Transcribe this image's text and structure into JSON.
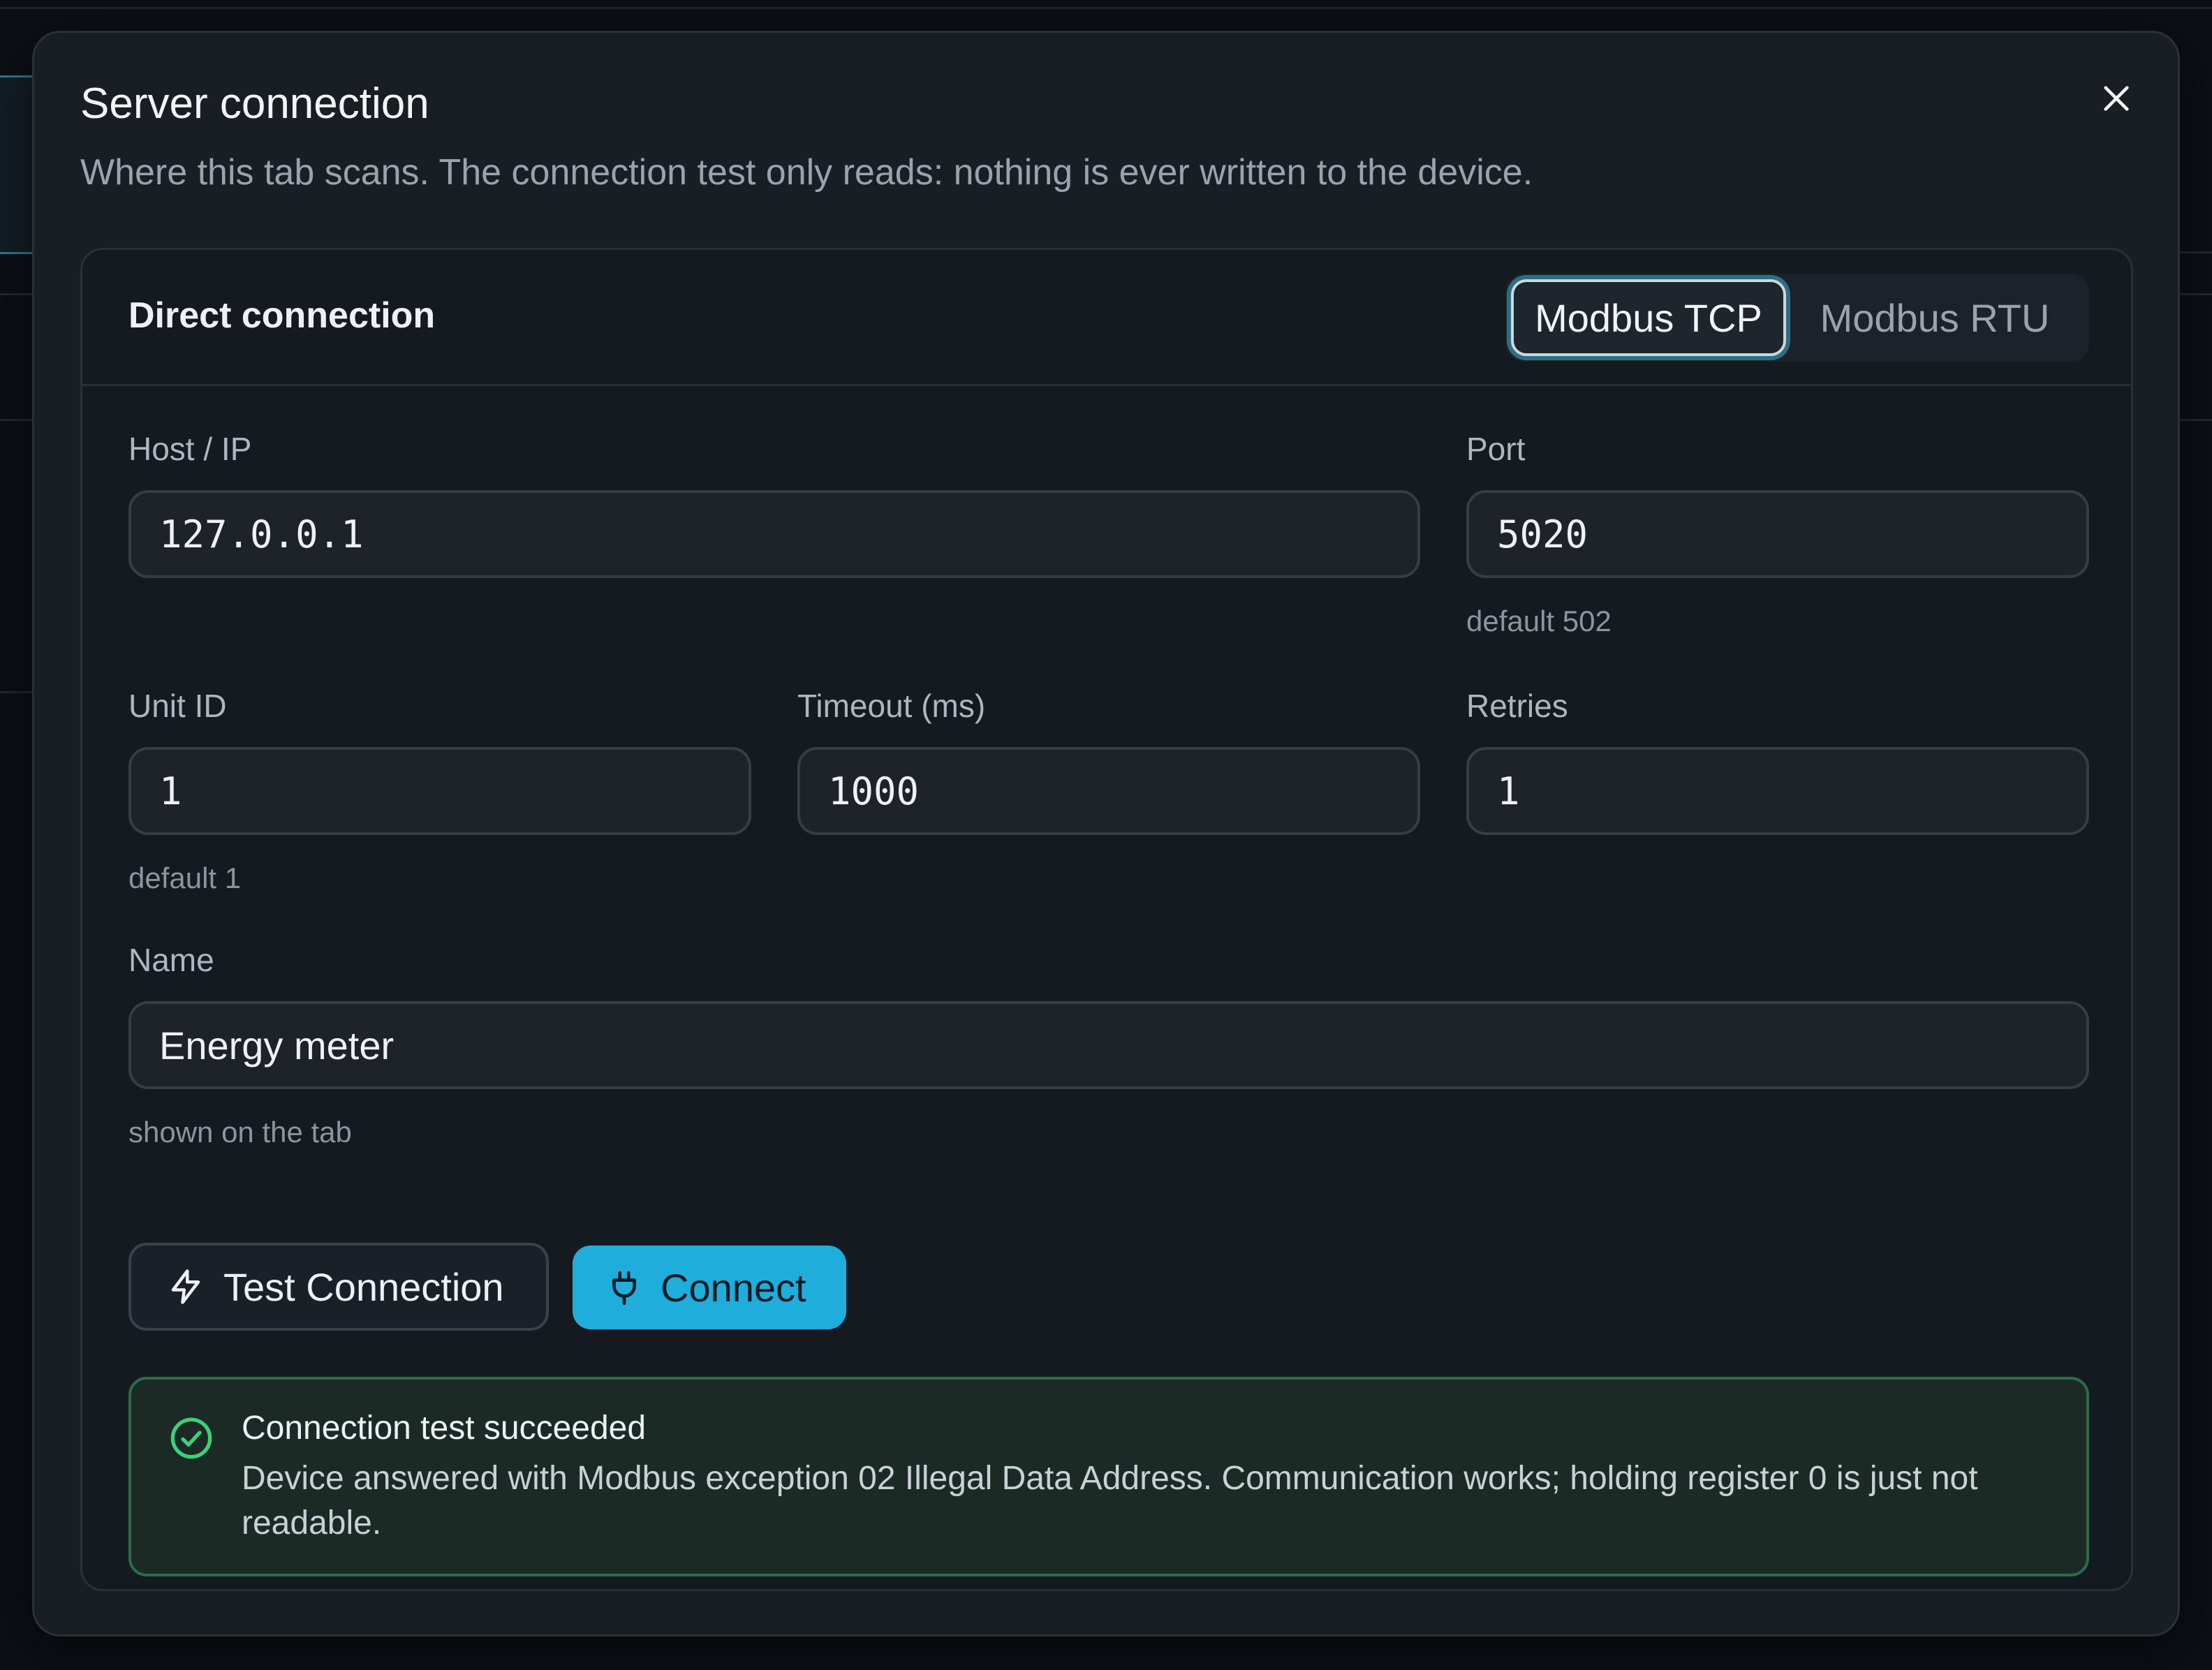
{
  "dialog": {
    "title": "Server connection",
    "subtitle": "Where this tab scans. The connection test only reads: nothing is ever written to the device.",
    "close_icon": "close-icon"
  },
  "card": {
    "title": "Direct connection",
    "protocol_options": [
      "Modbus TCP",
      "Modbus RTU"
    ],
    "selected_protocol": "Modbus TCP"
  },
  "fields": {
    "host": {
      "label": "Host / IP",
      "value": "127.0.0.1"
    },
    "port": {
      "label": "Port",
      "value": "5020",
      "hint": "default 502"
    },
    "unit_id": {
      "label": "Unit ID",
      "value": "1",
      "hint": "default 1"
    },
    "timeout": {
      "label": "Timeout (ms)",
      "value": "1000"
    },
    "retries": {
      "label": "Retries",
      "value": "1"
    },
    "name": {
      "label": "Name",
      "value": "Energy meter",
      "hint": "shown on the tab"
    }
  },
  "actions": {
    "test_label": "Test Connection",
    "test_icon": "lightning-icon",
    "connect_label": "Connect",
    "connect_icon": "plug-icon"
  },
  "result": {
    "icon": "check-circle-icon",
    "title": "Connection test succeeded",
    "message": "Device answered with Modbus exception 02 Illegal Data Address. Communication works; holding register 0 is just not readable."
  },
  "colors": {
    "accent": "#1faedb",
    "success_border": "#2c6b49",
    "success_icon": "#3ecf7a"
  }
}
